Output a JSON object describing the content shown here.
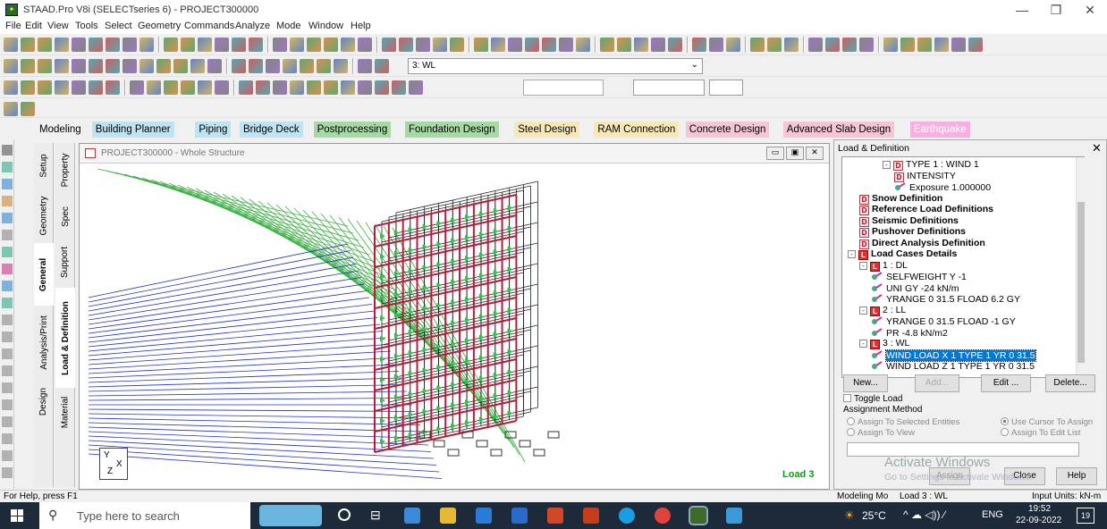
{
  "window": {
    "title": "STAAD.Pro V8i (SELECTseries 6) - PROJECT300000"
  },
  "menu": [
    "File",
    "Edit",
    "View",
    "Tools",
    "Select",
    "Geometry",
    "Commands",
    "Analyze",
    "Mode",
    "Window",
    "Help"
  ],
  "toolbar": {
    "load_select_value": "3: WL"
  },
  "workflow_tabs": [
    {
      "label": "Modeling",
      "color": "#f0f0f0"
    },
    {
      "label": "Building Planner",
      "color": "#bfe3f0"
    },
    {
      "label": "Piping",
      "color": "#bfe3f0"
    },
    {
      "label": "Bridge Deck",
      "color": "#bfe3f0"
    },
    {
      "label": "Postprocessing",
      "color": "#a7d9a4"
    },
    {
      "label": "Foundation Design",
      "color": "#a7d9a4"
    },
    {
      "label": "Steel Design",
      "color": "#f7e8b8"
    },
    {
      "label": "RAM Connection",
      "color": "#f7e8b8"
    },
    {
      "label": "Concrete Design",
      "color": "#f7c6d4"
    },
    {
      "label": "Advanced Slab Design",
      "color": "#f7c6d4"
    },
    {
      "label": "Earthquake",
      "color": "#f7b0e0"
    }
  ],
  "page_tabs_general": [
    "Setup",
    "Geometry",
    "General",
    "Analysis/Print",
    "Design"
  ],
  "page_tabs_sub": [
    "Property",
    "Spec",
    "Support",
    "Load & Definition",
    "Material"
  ],
  "viewport": {
    "title": "PROJECT300000 - Whole Structure",
    "load_label": "Load 3",
    "axis_y": "Y",
    "axis_x": "X",
    "axis_z": "Z"
  },
  "panel": {
    "title": "Load & Definition",
    "tree": [
      {
        "text": "TYPE 1 : WIND 1",
        "indent": 3,
        "icon": "D",
        "toggle": "-"
      },
      {
        "text": "INTENSITY",
        "indent": 4,
        "icon": "D"
      },
      {
        "text": "Exposure 1.000000",
        "indent": 4,
        "icon": "P"
      },
      {
        "text": "Snow Definition",
        "indent": 1,
        "icon": "D",
        "bold": true
      },
      {
        "text": "Reference Load Definitions",
        "indent": 1,
        "icon": "D",
        "bold": true
      },
      {
        "text": "Seismic Definitions",
        "indent": 1,
        "icon": "D",
        "bold": true
      },
      {
        "text": "Pushover Definitions",
        "indent": 1,
        "icon": "D",
        "bold": true
      },
      {
        "text": "Direct Analysis Definition",
        "indent": 1,
        "icon": "D",
        "bold": true
      },
      {
        "text": "Load Cases Details",
        "indent": 0,
        "icon": "L",
        "bold": true,
        "toggle": "-"
      },
      {
        "text": "1 : DL",
        "indent": 1,
        "icon": "L",
        "toggle": "-"
      },
      {
        "text": "SELFWEIGHT Y -1",
        "indent": 2,
        "icon": "P"
      },
      {
        "text": "UNI GY -24 kN/m",
        "indent": 2,
        "icon": "P"
      },
      {
        "text": "YRANGE 0 31.5 FLOAD 6.2 GY",
        "indent": 2,
        "icon": "P"
      },
      {
        "text": "2 : LL",
        "indent": 1,
        "icon": "L",
        "toggle": "-"
      },
      {
        "text": "YRANGE 0 31.5 FLOAD -1 GY",
        "indent": 2,
        "icon": "P"
      },
      {
        "text": "PR -4.8 kN/m2",
        "indent": 2,
        "icon": "P"
      },
      {
        "text": "3 : WL",
        "indent": 1,
        "icon": "L",
        "toggle": "-"
      },
      {
        "text": "WIND LOAD X 1 TYPE 1 YR 0 31.5",
        "indent": 2,
        "icon": "P",
        "selected": true
      },
      {
        "text": "WIND LOAD Z 1 TYPE 1 YR 0 31.5",
        "indent": 2,
        "icon": "P"
      }
    ],
    "btn_new": "New...",
    "btn_add": "Add...",
    "btn_edit": "Edit ...",
    "btn_delete": "Delete...",
    "toggle_load": "Toggle Load",
    "assignment_method": "Assignment Method",
    "opt_selected": "Assign To Selected Entities",
    "opt_cursor": "Use Cursor To Assign",
    "opt_view": "Assign To View",
    "opt_editlist": "Assign To Edit List",
    "btn_assign": "Assign",
    "btn_close": "Close",
    "btn_help": "Help",
    "watermark1": "Activate Windows",
    "watermark2": "Go to Settings to activate Windows."
  },
  "status": {
    "help": "For Help, press F1",
    "mode": "Modeling Mo",
    "load": "Load 3 : WL",
    "units": "Input Units:  kN-m"
  },
  "taskbar": {
    "search": "Type here to search",
    "temp": "25°C",
    "lang": "ENG",
    "time": "19:52",
    "date": "22-09-2022",
    "notif": "19"
  }
}
